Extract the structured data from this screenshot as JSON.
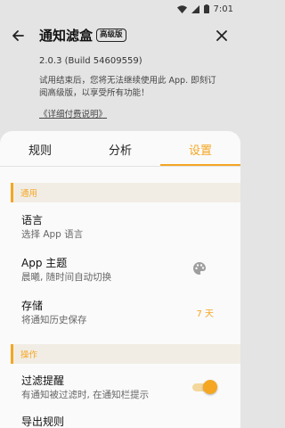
{
  "status_bar": {
    "time": "7:01"
  },
  "toolbar": {
    "title": "通知滤盒",
    "badge": "高级版"
  },
  "version_text": "2.0.3  (Build 54609559)",
  "trial_notice": "试用结束后，您将无法继续使用此 App. 即刻订阅高级版，以享受所有功能！",
  "payment_link": "《详细付费说明》",
  "tabs": [
    {
      "label": "规则"
    },
    {
      "label": "分析"
    },
    {
      "label": "设置"
    }
  ],
  "sections": {
    "general": "通用",
    "operations": "操作"
  },
  "items": {
    "language": {
      "title": "语言",
      "subtitle": "选择 App 语言"
    },
    "theme": {
      "title": "App 主题",
      "subtitle": "晨曦, 随时间自动切换",
      "icon": "palette-icon"
    },
    "storage": {
      "title": "存储",
      "subtitle": "将通知历史保存",
      "value": "7 天"
    },
    "filter_alert": {
      "title": "过滤提醒",
      "subtitle": "有通知被过滤时, 在通知栏提示",
      "toggle_on": true
    },
    "export": {
      "title": "导出规则"
    }
  },
  "colors": {
    "accent": "#f5a623",
    "background": "#e4e4e4",
    "sheet": "#fafafa"
  }
}
